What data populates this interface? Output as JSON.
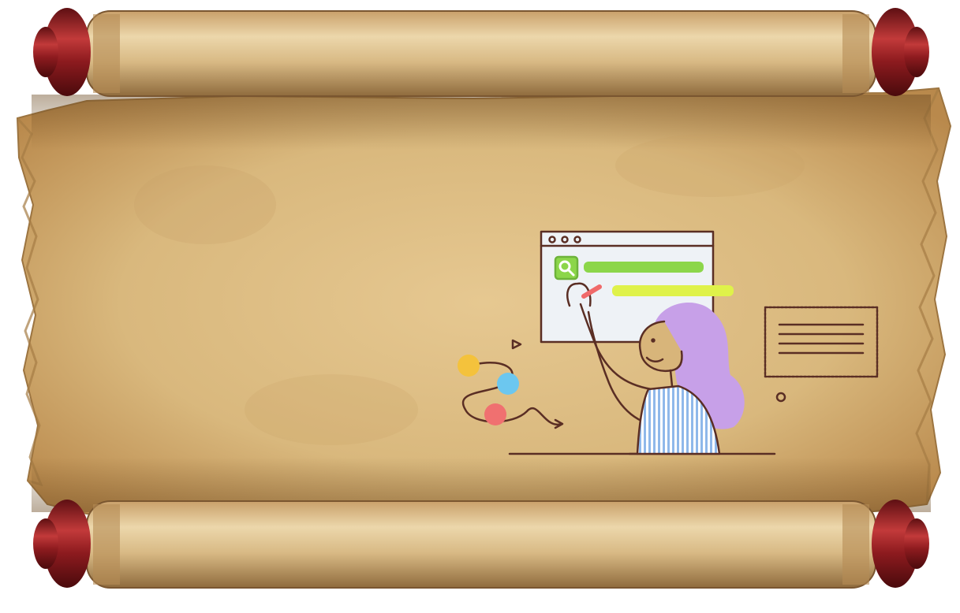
{
  "scene": {
    "subject": "parchment-scroll",
    "illustration": "woman-drawing-on-browser-window",
    "icons": [
      "search-icon",
      "note-card-icon",
      "triangle-icon",
      "circle-icon"
    ]
  },
  "colors": {
    "paper_light": "#e9cf9b",
    "paper_mid": "#d8b57a",
    "paper_dark": "#b88a4d",
    "roller_light": "#e8d0a0",
    "roller_dark": "#a07844",
    "knob_red": "#8e1b1f",
    "knob_highlight": "#c23a3a",
    "ink": "#5a2e24",
    "search_green": "#8cd64a",
    "search_yellow": "#dff24a",
    "hair_lilac": "#c7a0e8",
    "shirt_blue": "#8fb8ea",
    "dot_yellow": "#f4c23c",
    "dot_blue": "#6cc7ef",
    "dot_red": "#f07070",
    "pencil_pink": "#f06a6a",
    "window_fill": "#eef2f6"
  }
}
